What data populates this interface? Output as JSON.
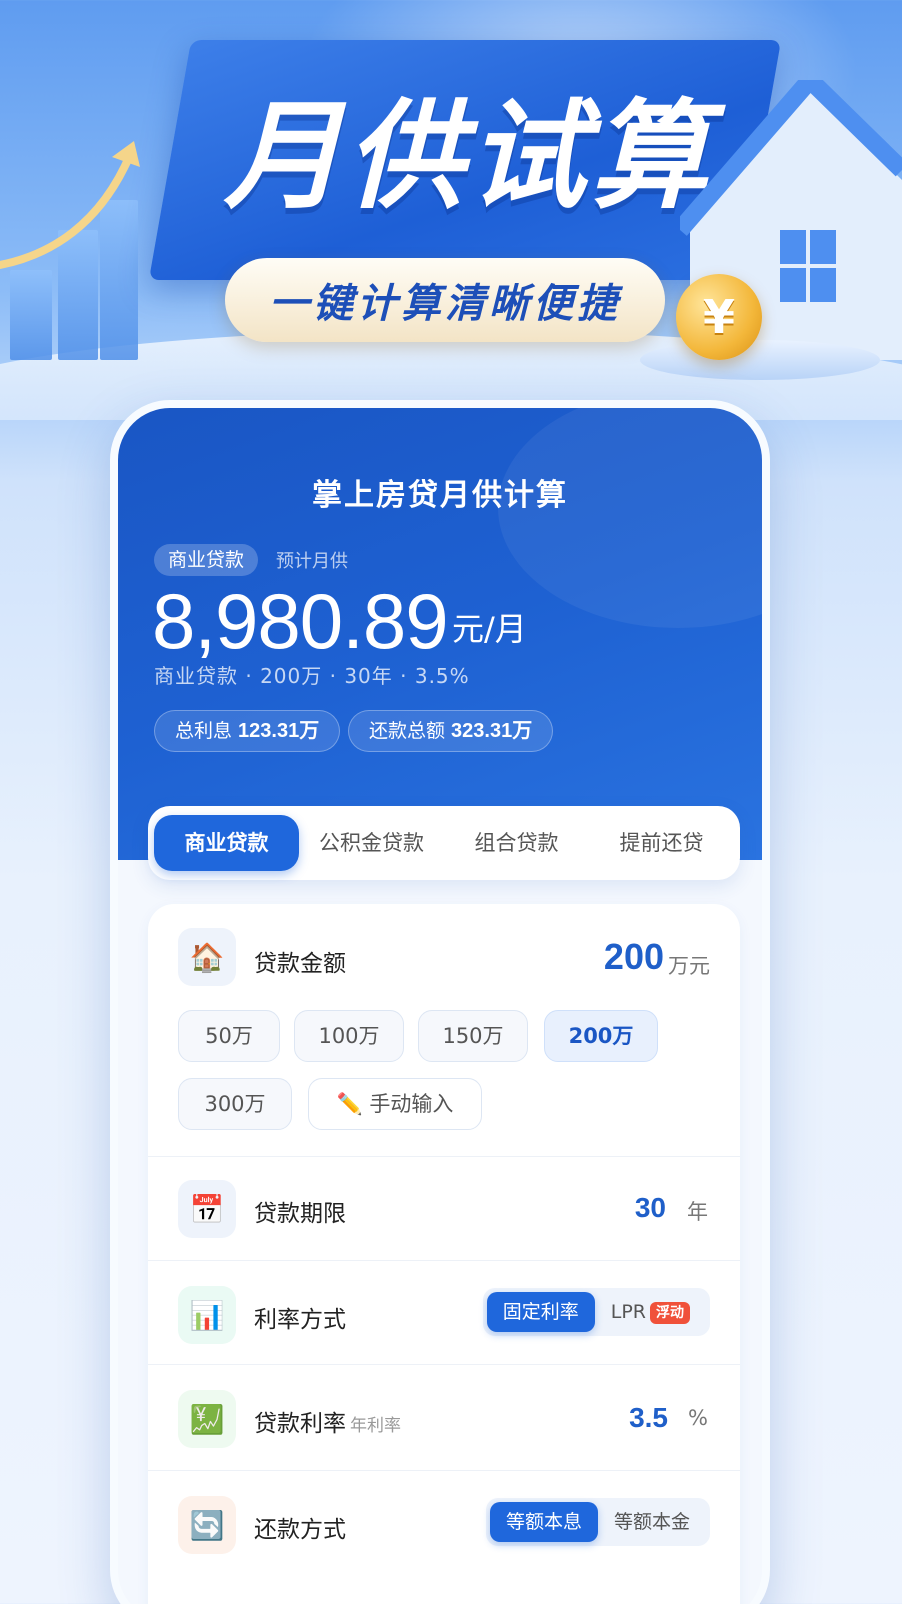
{
  "banner": {
    "title": "月供试算",
    "subtitle": "一键计算清晰便捷",
    "coin_symbol": "¥"
  },
  "header": {
    "app_title": "掌上房贷月供计算",
    "loan_tag": "商业贷款",
    "estimate_label": "预计月供",
    "monthly_amount": "8,980.89",
    "amount_unit": "元/月",
    "summary": "商业贷款 · 200万 · 30年 · 3.5%",
    "total_interest_label": "总利息",
    "total_interest_value": "123.31万",
    "total_repay_label": "还款总额",
    "total_repay_value": "323.31万"
  },
  "tabs": [
    {
      "label": "商业贷款",
      "active": true
    },
    {
      "label": "公积金贷款",
      "active": false
    },
    {
      "label": "组合贷款",
      "active": false
    },
    {
      "label": "提前还贷",
      "active": false
    }
  ],
  "loan_amount": {
    "icon": "house-icon",
    "label": "贷款金额",
    "value": "200",
    "unit": "万元",
    "options": [
      "50万",
      "100万",
      "150万",
      "200万",
      "300万"
    ],
    "selected": "200万",
    "manual_label": "手动输入"
  },
  "loan_term": {
    "icon": "calendar-icon",
    "label": "贷款期限",
    "value": "30",
    "unit": "年"
  },
  "rate_type": {
    "icon": "bar-chart-icon",
    "label": "利率方式",
    "options": [
      "固定利率",
      "LPR"
    ],
    "selected": "固定利率",
    "lpr_badge": "浮动"
  },
  "loan_rate": {
    "icon": "yen-chart-icon",
    "label": "贷款利率",
    "sublabel": "年利率",
    "value": "3.5",
    "unit": "%"
  },
  "repay_method": {
    "icon": "refresh-icon",
    "label": "还款方式",
    "options": [
      "等额本息",
      "等额本金"
    ],
    "selected": "等额本息"
  },
  "colors": {
    "primary": "#1f67dc",
    "hero_bg": "#1a56c4",
    "badge": "#f0513a",
    "coin": "#f3b73a"
  }
}
